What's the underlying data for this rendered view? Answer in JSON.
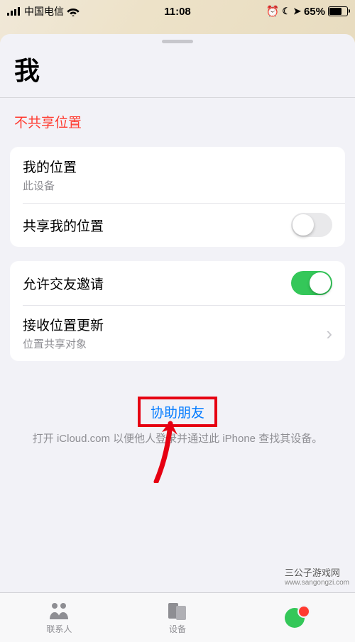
{
  "status": {
    "carrier": "中国电信",
    "time": "11:08",
    "battery_pct": "65%"
  },
  "page": {
    "title": "我"
  },
  "not_sharing": "不共享位置",
  "my_location": {
    "title": "我的位置",
    "subtitle": "此设备"
  },
  "share_location": {
    "title": "共享我的位置",
    "on": false
  },
  "friend_invite": {
    "title": "允许交友邀请",
    "on": true
  },
  "updates": {
    "title": "接收位置更新",
    "subtitle": "位置共享对象"
  },
  "help": {
    "link": "协助朋友",
    "desc": "打开 iCloud.com 以便他人登录并通过此 iPhone 查找其设备。"
  },
  "tabs": {
    "people": "联系人",
    "devices": "设备",
    "me": ""
  },
  "watermark": {
    "title": "三公子游戏网",
    "url": "www.sangongzi.com"
  }
}
